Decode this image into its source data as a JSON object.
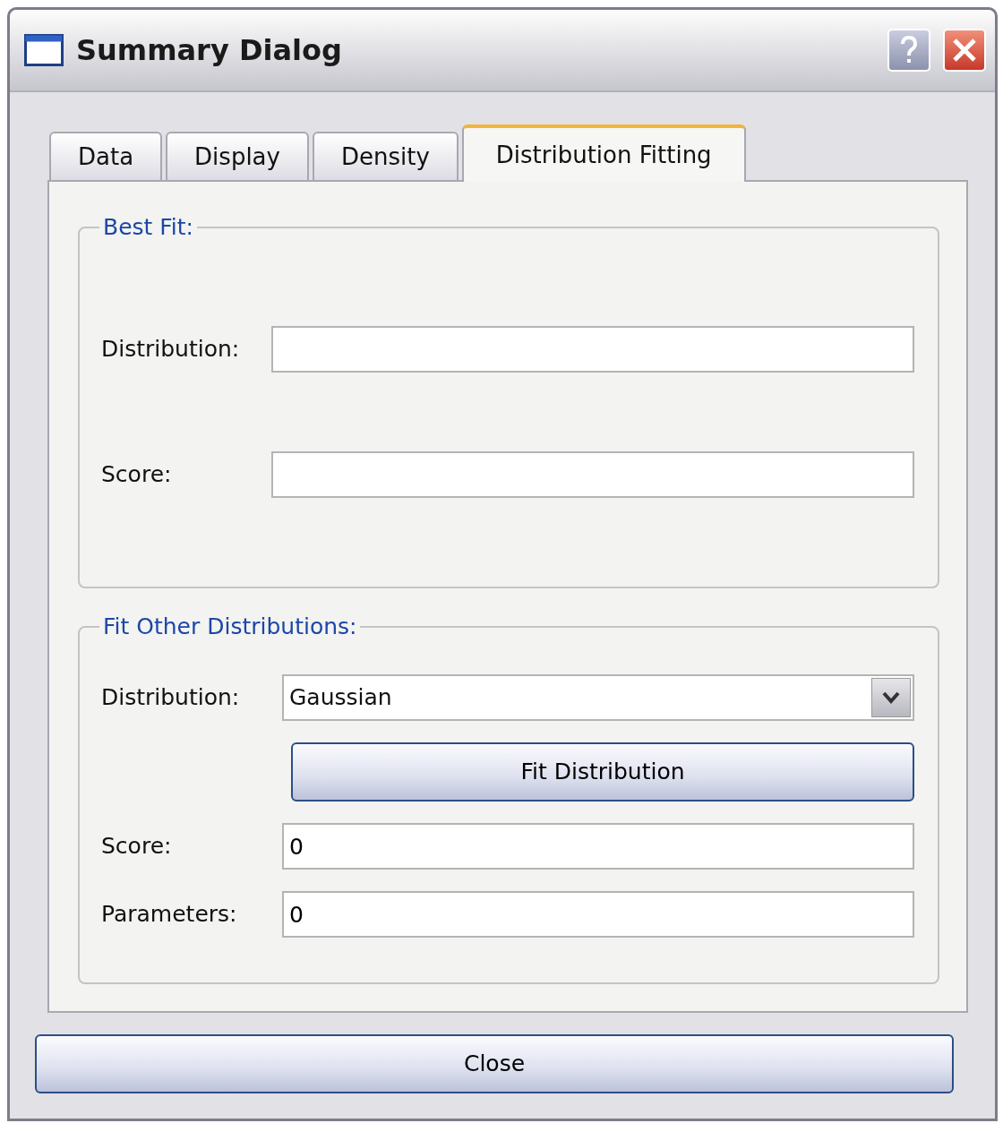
{
  "window": {
    "title": "Summary Dialog"
  },
  "tabs": [
    {
      "label": "Data",
      "selected": false
    },
    {
      "label": "Display",
      "selected": false
    },
    {
      "label": "Density",
      "selected": false
    },
    {
      "label": "Distribution Fitting",
      "selected": true
    }
  ],
  "best_fit": {
    "title": "Best Fit:",
    "fields": [
      {
        "label": "Distribution:"
      },
      {
        "label": "Score:"
      }
    ]
  },
  "fit_other": {
    "title": "Fit Other Distributions:",
    "distribution_label": "Distribution:",
    "distribution_value": "Gaussian",
    "fit_button": "Fit Distribution",
    "fields": [
      {
        "label": "Score:",
        "value": "0"
      },
      {
        "label": "Parameters:",
        "value": "0"
      }
    ]
  },
  "close_button": "Close"
}
